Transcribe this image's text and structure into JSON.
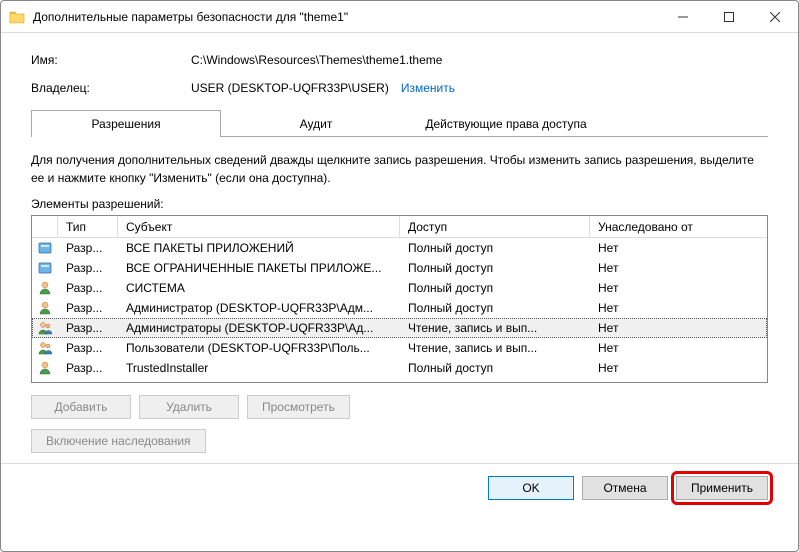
{
  "window": {
    "title": "Дополнительные параметры безопасности для \"theme1\""
  },
  "fields": {
    "name_label": "Имя:",
    "name_value": "C:\\Windows\\Resources\\Themes\\theme1.theme",
    "owner_label": "Владелец:",
    "owner_value": "USER (DESKTOP-UQFR33P\\USER)",
    "change_link": "Изменить"
  },
  "tabs": {
    "permissions": "Разрешения",
    "audit": "Аудит",
    "effective": "Действующие права доступа"
  },
  "help_text": "Для получения дополнительных сведений дважды щелкните запись разрешения. Чтобы изменить запись разрешения, выделите ее и нажмите кнопку \"Изменить\" (если она доступна).",
  "list_caption": "Элементы разрешений:",
  "columns": {
    "type": "Тип",
    "subject": "Субъект",
    "access": "Доступ",
    "inherited": "Унаследовано от"
  },
  "rows": [
    {
      "icon": "package",
      "type": "Разр...",
      "subject": "ВСЕ ПАКЕТЫ ПРИЛОЖЕНИЙ",
      "access": "Полный доступ",
      "inherited": "Нет"
    },
    {
      "icon": "package",
      "type": "Разр...",
      "subject": "ВСЕ ОГРАНИЧЕННЫЕ ПАКЕТЫ ПРИЛОЖЕ...",
      "access": "Полный доступ",
      "inherited": "Нет"
    },
    {
      "icon": "user",
      "type": "Разр...",
      "subject": "СИСТЕМА",
      "access": "Полный доступ",
      "inherited": "Нет"
    },
    {
      "icon": "user",
      "type": "Разр...",
      "subject": "Администратор (DESKTOP-UQFR33P\\Адм...",
      "access": "Полный доступ",
      "inherited": "Нет"
    },
    {
      "icon": "group",
      "type": "Разр...",
      "subject": "Администраторы (DESKTOP-UQFR33P\\Ад...",
      "access": "Чтение, запись и вып...",
      "inherited": "Нет",
      "selected": true
    },
    {
      "icon": "group",
      "type": "Разр...",
      "subject": "Пользователи (DESKTOP-UQFR33P\\Поль...",
      "access": "Чтение, запись и вып...",
      "inherited": "Нет"
    },
    {
      "icon": "user",
      "type": "Разр...",
      "subject": "TrustedInstaller",
      "access": "Полный доступ",
      "inherited": "Нет"
    }
  ],
  "buttons": {
    "add": "Добавить",
    "remove": "Удалить",
    "view": "Просмотреть",
    "enable_inherit": "Включение наследования",
    "ok": "OK",
    "cancel": "Отмена",
    "apply": "Применить"
  }
}
